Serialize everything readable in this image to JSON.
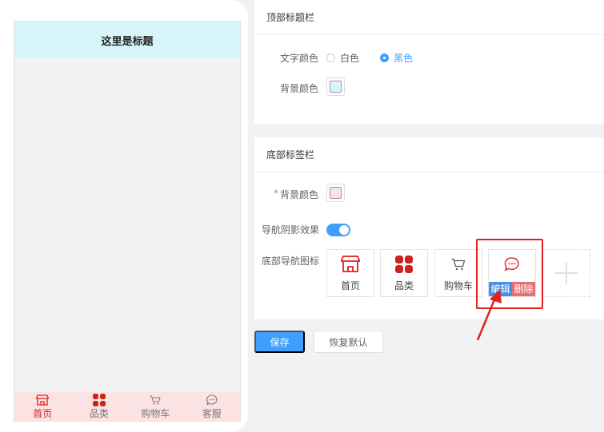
{
  "preview": {
    "header_title": "这里是标题",
    "tabs": [
      {
        "label": "首页",
        "icon": "store-icon"
      },
      {
        "label": "品类",
        "icon": "category-grid-icon"
      },
      {
        "label": "购物车",
        "icon": "cart-icon"
      },
      {
        "label": "客服",
        "icon": "chat-icon"
      }
    ]
  },
  "top_bar": {
    "section_title": "顶部标题栏",
    "text_color_label": "文字颜色",
    "text_color_options": [
      "白色",
      "黑色"
    ],
    "text_color_selected": "黑色",
    "bg_color_label": "背景颜色",
    "bg_color": "#d6f6fb"
  },
  "bottom_bar": {
    "section_title": "底部标签栏",
    "required_mark": "*",
    "bg_color_label": "背景颜色",
    "bg_color": "#fbe3e3",
    "shadow_label": "导航阴影效果",
    "shadow_enabled": true,
    "nav_icons_label": "底部导航图标",
    "nav_items": [
      {
        "label": "首页",
        "icon": "store-icon"
      },
      {
        "label": "品类",
        "icon": "category-grid-icon"
      },
      {
        "label": "购物车",
        "icon": "cart-icon"
      },
      {
        "label": "",
        "icon": "chat-icon",
        "edit_label": "编辑",
        "delete_label": "删除"
      }
    ],
    "add_icon": "plus-icon"
  },
  "actions": {
    "save_label": "保存",
    "reset_label": "恢复默认"
  },
  "colors": {
    "accent": "#409eff",
    "brand_red": "#e02020"
  }
}
